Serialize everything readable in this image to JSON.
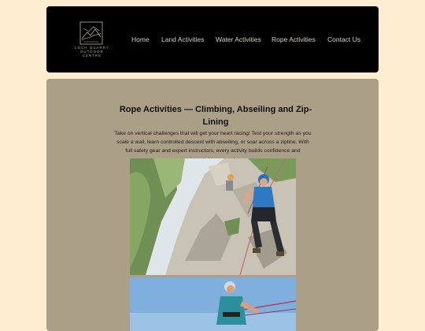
{
  "brand": {
    "logo_text": "Loch Quarry Outdoor Centre"
  },
  "nav": {
    "items": [
      {
        "label": "Home"
      },
      {
        "label": "Land Activities"
      },
      {
        "label": "Water Activities"
      },
      {
        "label": "Rope Activities"
      },
      {
        "label": "Contact Us"
      }
    ]
  },
  "main": {
    "heading": "Rope Activities — Climbing, Abseiling and Zip-Lining",
    "intro": "Take on vertical challenges that will get your heart racing! Test your strength as you scale a wall, learn controlled descent with abseiling, or soar across a zipline. With full safety gear and expert instructors, every activity builds confidence and unforgettable memories."
  },
  "colors": {
    "page_bg": "#ffedd2",
    "header_bg": "#000000",
    "content_bg": "#ab9f88",
    "nav_text": "#d9d0bf"
  }
}
